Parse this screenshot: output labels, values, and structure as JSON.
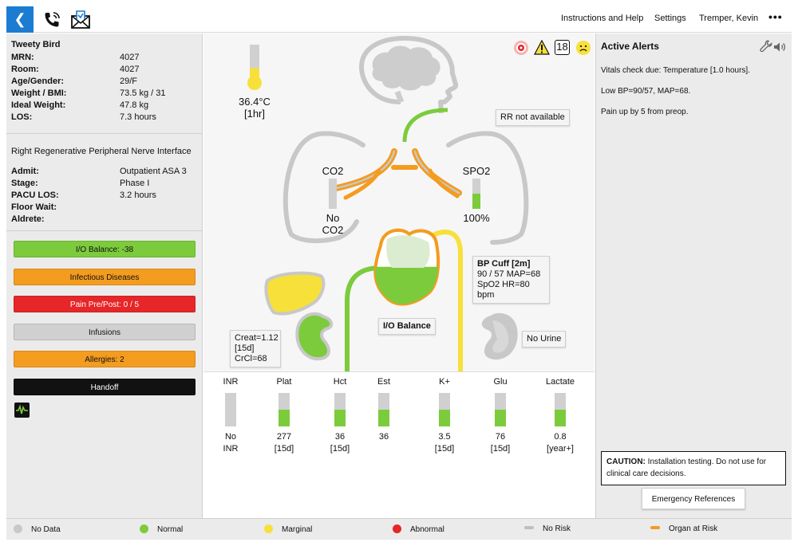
{
  "colors": {
    "accent": "#1c7cd2",
    "normal": "#7ccb3c",
    "marginal": "#f7e03a",
    "abnormal": "#e62628",
    "nodata": "#c8c8c8",
    "organ_risk": "#f39c1f",
    "no_risk": "#bfbfbf"
  },
  "icons": {
    "back": "chevron-left-icon",
    "phone": "phone-icon",
    "mail": "mail-icon",
    "more": "more-icon",
    "wrench": "wrench-icon",
    "speaker": "speaker-icon",
    "waveform": "waveform-icon",
    "target": "target-icon",
    "warning": "warning-icon",
    "sad_face": "sad-face-icon"
  },
  "header": {
    "instructions": "Instructions and Help",
    "settings": "Settings",
    "user": "Tremper, Kevin",
    "more": "•••"
  },
  "patient": {
    "name": "Tweety Bird",
    "fields": [
      {
        "label": "MRN:",
        "value": "4027"
      },
      {
        "label": "Room:",
        "value": "4027"
      },
      {
        "label": "Age/Gender:",
        "value": "29/F"
      },
      {
        "label": "Weight / BMI:",
        "value": "73.5 kg / 31"
      },
      {
        "label": "Ideal Weight:",
        "value": "47.8 kg"
      },
      {
        "label": "LOS:",
        "value": "7.3 hours"
      }
    ],
    "procedure": "Right Regenerative Peripheral Nerve Interface",
    "stay": [
      {
        "label": "Admit:",
        "value": "Outpatient ASA 3"
      },
      {
        "label": "Stage:",
        "value": "Phase I"
      },
      {
        "label": "PACU LOS:",
        "value": "3.2 hours"
      },
      {
        "label": "Floor Wait:",
        "value": ""
      },
      {
        "label": "Aldrete:",
        "value": ""
      }
    ]
  },
  "status_buttons": [
    {
      "label": "I/O Balance: -38",
      "color": "#7ccb3c"
    },
    {
      "label": "Infectious Diseases",
      "color": "#f39c1f"
    },
    {
      "label": "Pain Pre/Post: 0 / 5",
      "color": "#e62628"
    },
    {
      "label": "Infusions",
      "color": "#d0d0d0"
    },
    {
      "label": "Allergies: 2",
      "color": "#f39c1f"
    },
    {
      "label": "Handoff",
      "color": "#111111"
    }
  ],
  "vitals": {
    "temp_value": "36.4°C",
    "temp_age": "[1hr]",
    "temp_level": 0.3,
    "rr": "RR not available",
    "co2_label": "CO2",
    "co2_value_1": "No",
    "co2_value_2": "CO2",
    "spo2_label": "SPO2",
    "spo2_value": "100%",
    "spo2_level": 0.5,
    "bp_title": "BP Cuff [2m]",
    "bp_line1": "90 / 57 MAP=68",
    "bp_line2": "SpO2 HR=80 bpm",
    "io_balance": "I/O Balance",
    "io_level": 0.55,
    "creat_1": "Creat=1.12",
    "creat_2": "[15d]",
    "creat_3": "CrCl=68",
    "urine": "No Urine",
    "pain_score": "18"
  },
  "labs": [
    {
      "name": "INR",
      "level": 0,
      "val1": "No",
      "val2": "INR"
    },
    {
      "name": "Plat",
      "level": 0.5,
      "val1": "277",
      "val2": "[15d]"
    },
    {
      "name": "Hct",
      "level": 0.5,
      "val1": "36",
      "val2": "[15d]"
    },
    {
      "name": "Est",
      "level": 0.5,
      "val1": "36",
      "val2": ""
    },
    {
      "name": "K+",
      "level": 0.5,
      "val1": "3.5",
      "val2": "[15d]"
    },
    {
      "name": "Glu",
      "level": 0.5,
      "val1": "76",
      "val2": "[15d]"
    },
    {
      "name": "Lactate",
      "level": 0.5,
      "val1": "0.8",
      "val2": "[year+]"
    }
  ],
  "alerts": {
    "title": "Active Alerts",
    "items": [
      "Vitals check due: Temperature [1.0 hours].",
      "Low BP=90/57, MAP=68.",
      "Pain up by 5 from preop."
    ],
    "caution_label": "CAUTION:",
    "caution_text": "Installation testing. Do not use for clinical care decisions.",
    "emergency": "Emergency References"
  },
  "legend": [
    {
      "label": "No Data",
      "kind": "dot",
      "color": "#c8c8c8"
    },
    {
      "label": "Normal",
      "kind": "dot",
      "color": "#7ccb3c"
    },
    {
      "label": "Marginal",
      "kind": "dot",
      "color": "#f7e03a"
    },
    {
      "label": "Abnormal",
      "kind": "dot",
      "color": "#e62628"
    },
    {
      "label": "No Risk",
      "kind": "dash",
      "color": "#bfbfbf"
    },
    {
      "label": "Organ at Risk",
      "kind": "dash",
      "color": "#f39c1f"
    }
  ]
}
